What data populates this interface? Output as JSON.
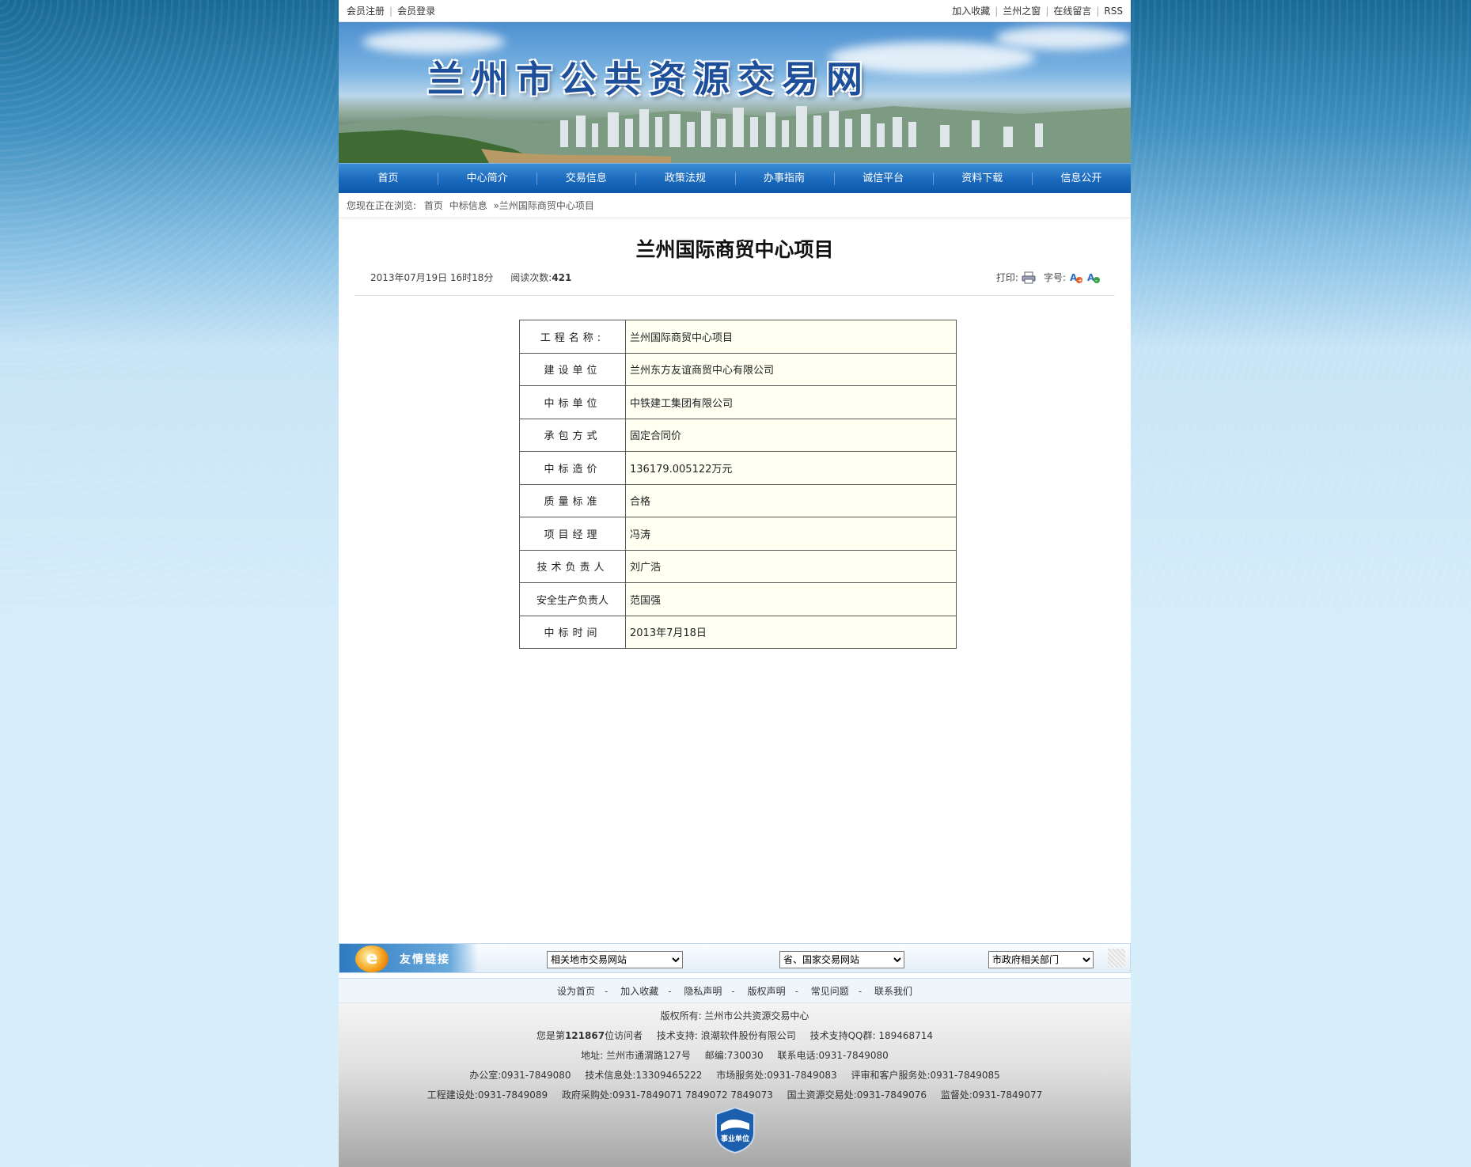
{
  "topbar": {
    "left": [
      "会员注册",
      "会员登录"
    ],
    "right": [
      "加入收藏",
      "兰州之窗",
      "在线留言",
      "RSS"
    ]
  },
  "banner": {
    "title": "兰州市公共资源交易网"
  },
  "nav": [
    "首页",
    "中心简介",
    "交易信息",
    "政策法规",
    "办事指南",
    "诚信平台",
    "资料下载",
    "信息公开"
  ],
  "breadcrumb": {
    "prefix": "您现在正在浏览:",
    "home": "首页",
    "section": "中标信息",
    "current": "»兰州国际商贸中心项目"
  },
  "article": {
    "title": "兰州国际商贸中心项目",
    "date": "2013年07月19日 16时18分",
    "reads_label": "阅读次数:",
    "reads": "421",
    "print_label": "打印:",
    "font_label": "字号:"
  },
  "table": [
    {
      "key": "工程名称:",
      "value": "兰州国际商贸中心项目"
    },
    {
      "key": "建设单位",
      "value": "兰州东方友谊商贸中心有限公司"
    },
    {
      "key": "中标单位",
      "value": "中铁建工集团有限公司"
    },
    {
      "key": "承包方式",
      "value": "固定合同价"
    },
    {
      "key": "中标造价",
      "value": "136179.005122万元"
    },
    {
      "key": "质量标准",
      "value": "合格"
    },
    {
      "key": "项目经理",
      "value": "冯涛"
    },
    {
      "key": "技术负责人",
      "value": "刘广浩"
    },
    {
      "key": "安全生产负责人",
      "value": "范国强"
    },
    {
      "key": "中标时间",
      "value": "2013年7月18日"
    }
  ],
  "links": {
    "label": "友情链接",
    "select1": "相关地市交易网站",
    "select2": "省、国家交易网站",
    "select3": "市政府相关部门"
  },
  "footer_nav": [
    "设为首页",
    "加入收藏",
    "隐私声明",
    "版权声明",
    "常见问题",
    "联系我们"
  ],
  "footer": {
    "copyright": "版权所有: 兰州市公共资源交易中心",
    "visitor_prefix": "您是第",
    "visitor_count": "121867",
    "visitor_suffix": "位访问者",
    "tech_support": "技术支持: 浪潮软件股份有限公司",
    "qq": "技术支持QQ群: 189468714",
    "address": "地址: 兰州市通渭路127号",
    "postcode": "邮编:730030",
    "phone": "联系电话:0931-7849080",
    "office": "办公室:0931-7849080",
    "tech_office": "技术信息处:13309465222",
    "market": "市场服务处:0931-7849083",
    "review": "评审和客户服务处:0931-7849085",
    "construction": "工程建设处:0931-7849089",
    "procurement": "政府采购处:0931-7849071 7849072 7849073",
    "land": "国土资源交易处:0931-7849076",
    "supervision": "监督处:0931-7849077",
    "emblem_text": "事业单位"
  }
}
